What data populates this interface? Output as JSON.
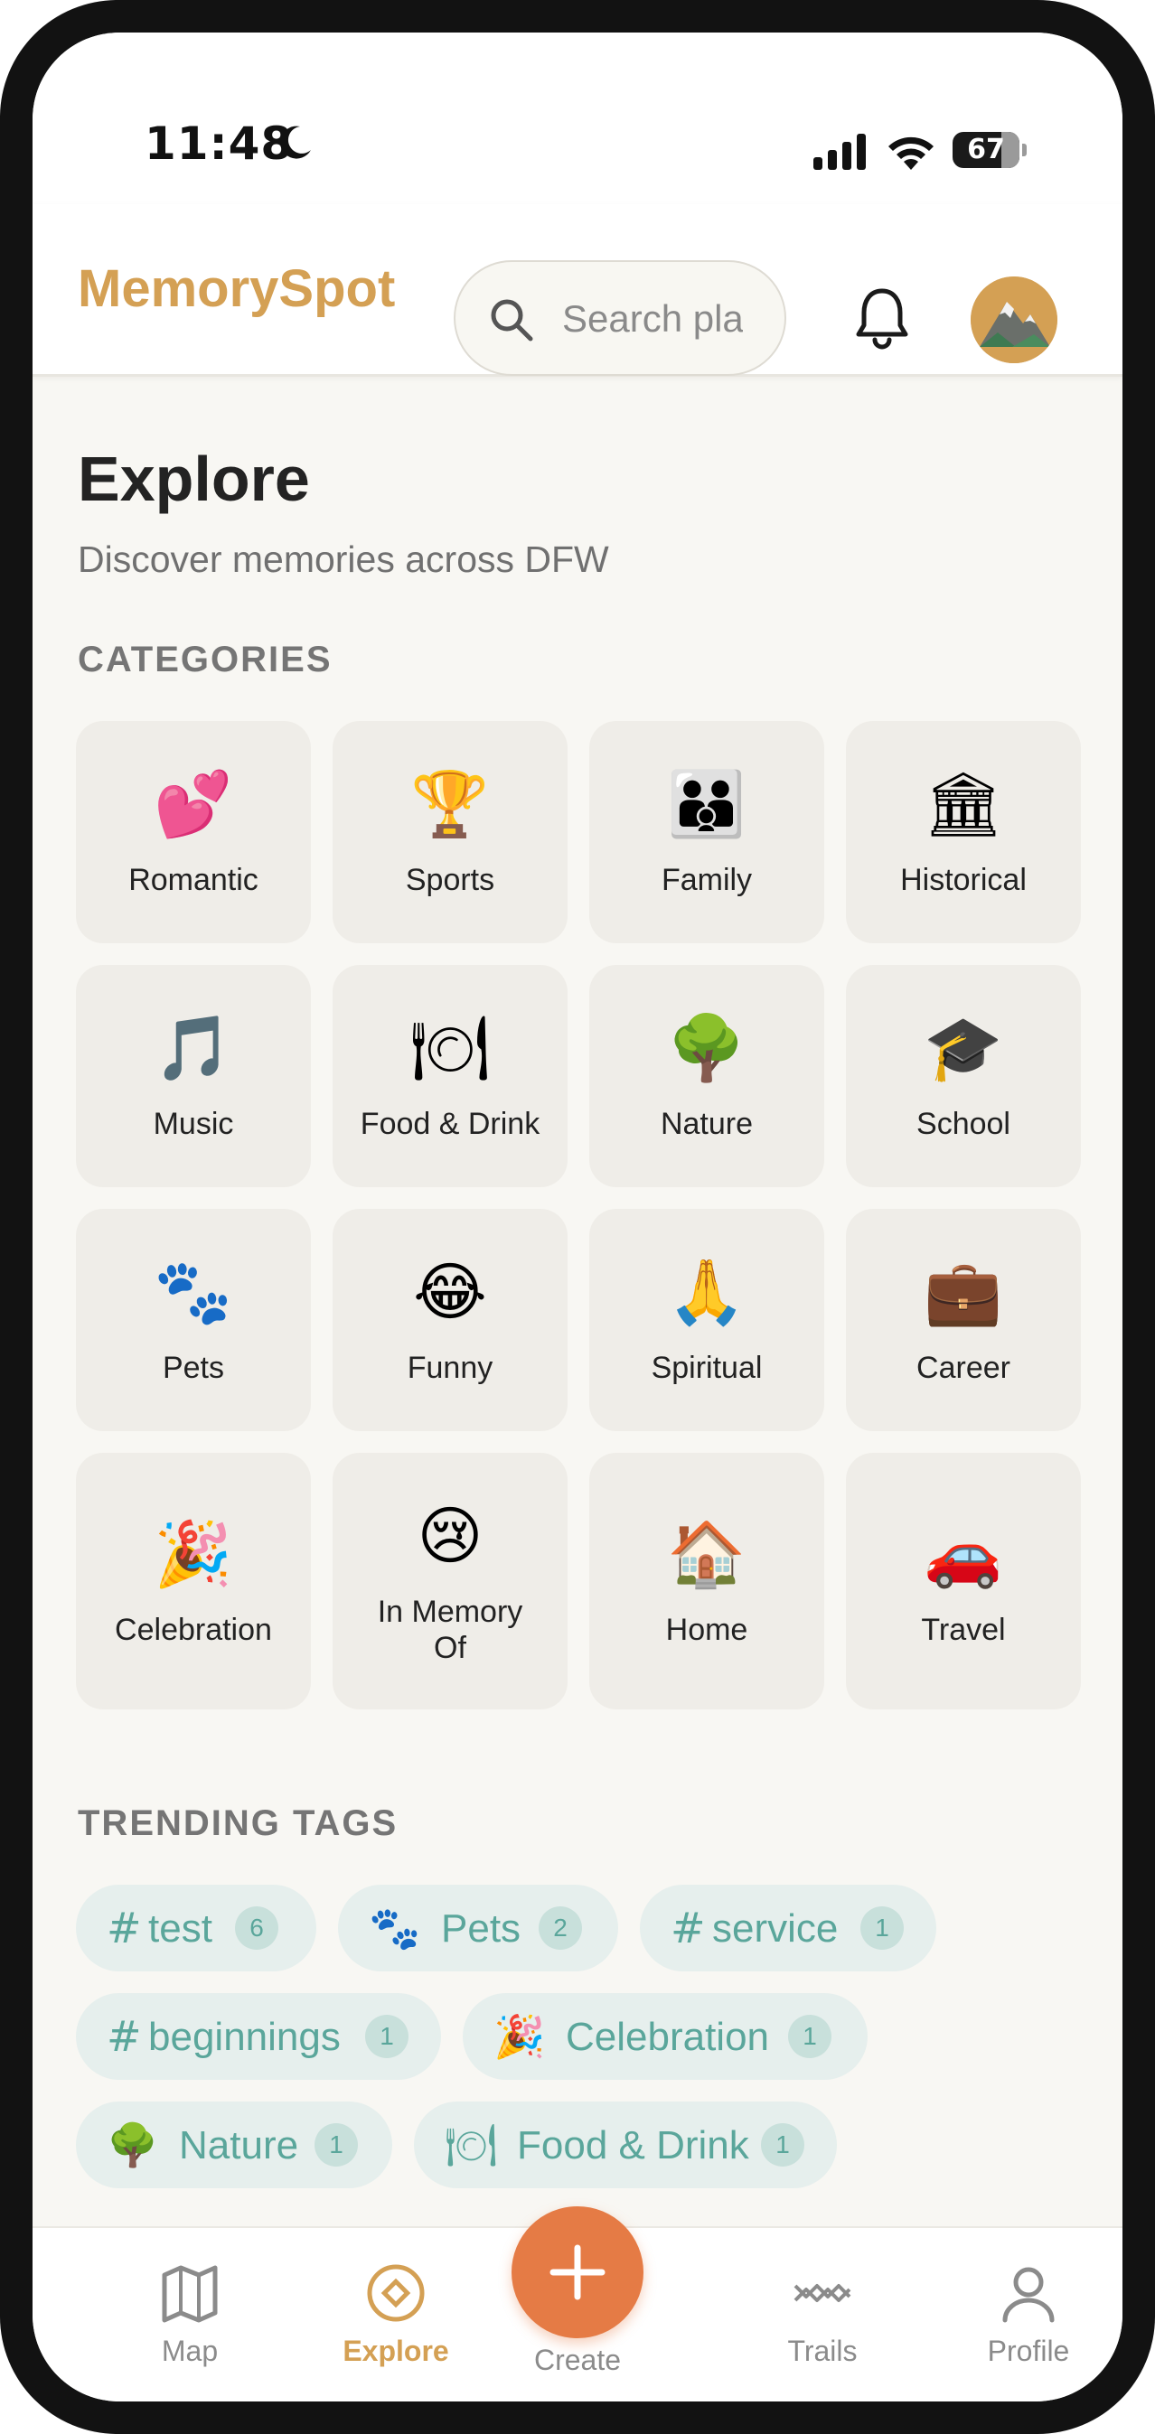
{
  "status_bar": {
    "time": "11:48",
    "battery": "67",
    "icons": [
      "moon-icon",
      "cellular-signal-icon",
      "wifi-icon",
      "battery-icon"
    ]
  },
  "header": {
    "brand": "MemorySpot",
    "search_placeholder": "Search places",
    "icons": [
      "search-icon",
      "bell-icon",
      "avatar"
    ]
  },
  "page": {
    "title": "Explore",
    "subtitle": "Discover memories across DFW",
    "categories_label": "CATEGORIES",
    "trending_label": "TRENDING TAGS"
  },
  "categories": [
    {
      "emoji": "💕",
      "label": "Romantic"
    },
    {
      "emoji": "🏆",
      "label": "Sports"
    },
    {
      "emoji": "👪",
      "label": "Family"
    },
    {
      "emoji": "🏛",
      "label": "Historical"
    },
    {
      "emoji": "🎵",
      "label": "Music"
    },
    {
      "emoji": "🍽",
      "label": "Food & Drink"
    },
    {
      "emoji": "🌳",
      "label": "Nature"
    },
    {
      "emoji": "🎓",
      "label": "School"
    },
    {
      "emoji": "🐾",
      "label": "Pets"
    },
    {
      "emoji": "😂",
      "label": "Funny"
    },
    {
      "emoji": "🙏",
      "label": "Spiritual"
    },
    {
      "emoji": "💼",
      "label": "Career"
    },
    {
      "emoji": "🎉",
      "label": "Celebration"
    },
    {
      "emoji": "😢",
      "label": "In Memory Of"
    },
    {
      "emoji": "🏠",
      "label": "Home"
    },
    {
      "emoji": "🚗",
      "label": "Travel"
    }
  ],
  "trending_tags": [
    {
      "icon": "#",
      "name": "test",
      "count": "6"
    },
    {
      "icon": "🐾",
      "name": "Pets",
      "count": "2"
    },
    {
      "icon": "#",
      "name": "service",
      "count": "1"
    },
    {
      "icon": "#",
      "name": "beginnings",
      "count": "1"
    },
    {
      "icon": "🎉",
      "name": "Celebration",
      "count": "1"
    },
    {
      "icon": "🌳",
      "name": "Nature",
      "count": "1"
    },
    {
      "icon": "🍽",
      "name": "Food & Drink",
      "count": "1"
    }
  ],
  "bottom_nav": {
    "items": [
      {
        "label": "Map",
        "icon": "map-icon"
      },
      {
        "label": "Explore",
        "icon": "compass-icon",
        "active": true
      },
      {
        "label": "Create",
        "icon": "plus-icon"
      },
      {
        "label": "Trails",
        "icon": "trails-icon"
      },
      {
        "label": "Profile",
        "icon": "person-icon"
      }
    ]
  },
  "colors": {
    "brand": "#d4a054",
    "accent_orange": "#e57b45",
    "tag_teal": "#5aa69b",
    "tile_bg": "#efede8",
    "page_bg": "#f8f7f3"
  }
}
